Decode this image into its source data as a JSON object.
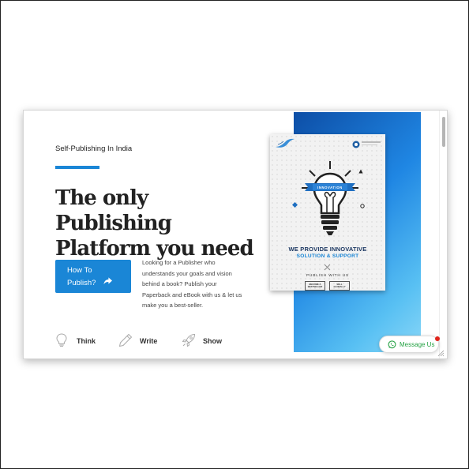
{
  "hero": {
    "eyebrow": "Self-Publishing In India",
    "headline_line1": "The only Publishing",
    "headline_line2": "Platform you need",
    "cta_line1": "How To",
    "cta_line2": "Publish?",
    "description": "Looking for a Publisher who understands your goals and vision behind a book? Publish your Paperback and eBook with us & let us make you a best-seller."
  },
  "steps": [
    {
      "label": "Think",
      "icon": "lightbulb-icon"
    },
    {
      "label": "Write",
      "icon": "pencil-icon"
    },
    {
      "label": "Show",
      "icon": "rocket-icon"
    }
  ],
  "poster": {
    "heading_line1": "WE PROVIDE INNOVATIVE",
    "heading_line2": "SOLUTION & SUPPORT",
    "publish_with_us": "PUBLISH WITH US",
    "box1_line1": "BECOME A",
    "box1_line2": "BESTSELLER",
    "box2_line1": "SELL",
    "box2_line2": "GLOBALLY",
    "footer_brand": "WRITEFARE PUBLISHERS"
  },
  "chat": {
    "label": "Message Us",
    "icon": "whatsapp-icon"
  },
  "colors": {
    "accent": "#1a86d6",
    "whatsapp_green": "#25a244",
    "notification": "#e0241b"
  }
}
